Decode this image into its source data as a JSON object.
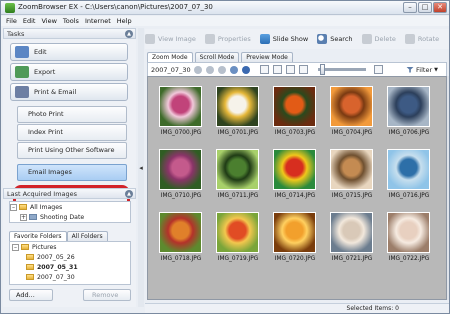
{
  "window": {
    "title": "ZoomBrowser EX  -  C:\\Users\\canon\\Pictures\\2007_07_30"
  },
  "menu": [
    "File",
    "Edit",
    "View",
    "Tools",
    "Internet",
    "Help"
  ],
  "tasks": {
    "header": "Tasks",
    "buttons": [
      {
        "label": "Edit",
        "icon": "edit-icon",
        "color": "#5b86c4"
      },
      {
        "label": "Export",
        "icon": "export-icon",
        "color": "#4f9a58"
      },
      {
        "label": "Print & Email",
        "icon": "print-icon",
        "color": "#6d7fa3"
      }
    ],
    "sub_items": [
      {
        "label": "Photo Print"
      },
      {
        "label": "Index Print"
      },
      {
        "label": "Print Using Other Software"
      },
      {
        "label": "Email Images"
      }
    ]
  },
  "last_acquired": {
    "header": "Last Acquired Images",
    "items": [
      {
        "label": "All Images",
        "expander": "–"
      },
      {
        "label": "Shooting Date",
        "expander": "+"
      }
    ]
  },
  "favorites": {
    "tabs": [
      "Favorite Folders",
      "All Folders"
    ],
    "items": [
      {
        "label": "Pictures",
        "expander": "–"
      },
      {
        "label": "2007_05_26"
      },
      {
        "label": "2007_05_31"
      },
      {
        "label": "2007_07_30"
      }
    ],
    "add_label": "Add...",
    "remove_label": "Remove"
  },
  "toolbar": {
    "items": [
      {
        "label": "View Image",
        "disabled": true,
        "icon": "view-image-icon"
      },
      {
        "label": "Properties",
        "disabled": true,
        "icon": "properties-icon"
      },
      {
        "label": "Slide Show",
        "disabled": false,
        "icon": "slideshow-icon"
      },
      {
        "label": "Search",
        "disabled": false,
        "icon": "search-icon"
      },
      {
        "label": "Delete",
        "disabled": true,
        "icon": "delete-icon"
      },
      {
        "label": "Rotate",
        "disabled": true,
        "icon": "rotate-icon"
      }
    ]
  },
  "view_tabs": [
    "Zoom Mode",
    "Scroll Mode",
    "Preview Mode"
  ],
  "viewbar": {
    "folder_name": "2007_07_30",
    "filter_label": "Filter"
  },
  "thumbnails": [
    {
      "name": "IMG_0700.JPG",
      "colors": [
        "#c1437a",
        "#3e6b2a",
        "#f1c8da"
      ]
    },
    {
      "name": "IMG_0701.JPG",
      "colors": [
        "#f6f3ea",
        "#2f4420",
        "#e6b83a"
      ]
    },
    {
      "name": "IMG_0703.JPG",
      "colors": [
        "#e25b16",
        "#6b2b0f",
        "#2a4a1d"
      ]
    },
    {
      "name": "IMG_0704.JPG",
      "colors": [
        "#d8632d",
        "#f29a3b",
        "#7a3a12"
      ]
    },
    {
      "name": "IMG_0706.JPG",
      "colors": [
        "#3d5a84",
        "#a7b6c6",
        "#2c3f5b"
      ]
    },
    {
      "name": "IMG_0710.JPG",
      "colors": [
        "#c45a8c",
        "#2f5d23",
        "#8a3468"
      ]
    },
    {
      "name": "IMG_0711.JPG",
      "colors": [
        "#4b7f2f",
        "#a8d06a",
        "#1f3b15"
      ]
    },
    {
      "name": "IMG_0714.JPG",
      "colors": [
        "#d72e1f",
        "#2a8a3c",
        "#f0c81b"
      ]
    },
    {
      "name": "IMG_0715.JPG",
      "colors": [
        "#c48b52",
        "#e8d6bf",
        "#6f5030"
      ]
    },
    {
      "name": "IMG_0716.JPG",
      "colors": [
        "#2d6fa8",
        "#8fc4e8",
        "#c7dfee"
      ]
    },
    {
      "name": "IMG_0718.JPG",
      "colors": [
        "#e0802a",
        "#5d8a2e",
        "#b4322a"
      ]
    },
    {
      "name": "IMG_0719.JPG",
      "colors": [
        "#e14c24",
        "#7aa53a",
        "#f3c74e"
      ]
    },
    {
      "name": "IMG_0720.JPG",
      "colors": [
        "#f2a02c",
        "#7a3d0c",
        "#ffd060"
      ]
    },
    {
      "name": "IMG_0721.JPG",
      "colors": [
        "#d9c9b8",
        "#6c7d8f",
        "#f2e8dc"
      ]
    },
    {
      "name": "IMG_0722.JPG",
      "colors": [
        "#e8d0c0",
        "#9c7e6a",
        "#f6ebe1"
      ]
    }
  ],
  "status": {
    "selected": "Selected Items: 0"
  }
}
